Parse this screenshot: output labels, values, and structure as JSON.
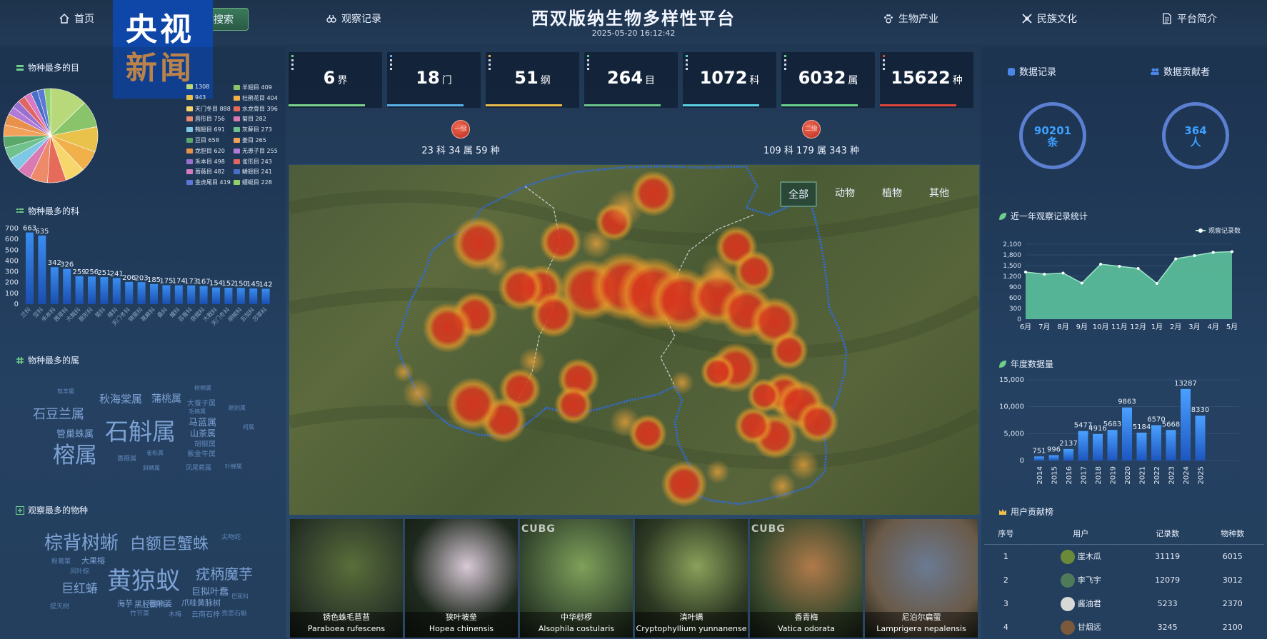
{
  "header": {
    "title": "西双版纳生物多样性平台",
    "datetime": "2025-05-20 16:12:42",
    "nav": {
      "home": "首页",
      "search": "物种搜索",
      "search_visible": "种搜索",
      "records": "观察记录",
      "industry": "生物产业",
      "culture": "民族文化",
      "about": "平台简介"
    }
  },
  "logo": {
    "line1": "央视",
    "line2": "新闻"
  },
  "left": {
    "order_title": "物种最多的目",
    "order_legend": [
      {
        "label": "1308",
        "color": "#b8d97a"
      },
      {
        "label": "半翅目 409",
        "color": "#8ac46a"
      },
      {
        "label": "943",
        "color": "#e8c24a"
      },
      {
        "label": "杜鹃花目 404",
        "color": "#f0b14a"
      },
      {
        "label": "天门冬目 888",
        "color": "#f7d66c"
      },
      {
        "label": "水龙骨目 396",
        "color": "#e56b5a"
      },
      {
        "label": "唇形目 756",
        "color": "#ec8a6a"
      },
      {
        "label": "菊目 282",
        "color": "#d97ab5"
      },
      {
        "label": "鞘翅目 691",
        "color": "#7ec8e6"
      },
      {
        "label": "灰藓目 273",
        "color": "#6fc18e"
      },
      {
        "label": "豆目 658",
        "color": "#5aa86a"
      },
      {
        "label": "姜目 265",
        "color": "#f2a15a"
      },
      {
        "label": "龙胆目 620",
        "color": "#e8914a"
      },
      {
        "label": "无患子目 255",
        "color": "#b07ad6"
      },
      {
        "label": "禾本目 498",
        "color": "#9a6fd0"
      },
      {
        "label": "雀形目 243",
        "color": "#e06666"
      },
      {
        "label": "蔷薇目 482",
        "color": "#d87ac2"
      },
      {
        "label": "鳞翅目 241",
        "color": "#4a6fc8"
      },
      {
        "label": "金虎尾目 419",
        "color": "#5a78d6"
      },
      {
        "label": "蜻蜓目 228",
        "color": "#8fd06a"
      }
    ],
    "order_pie": [
      1308,
      943,
      888,
      756,
      691,
      658,
      620,
      498,
      482,
      419,
      409,
      404,
      396,
      282,
      273,
      265,
      255,
      243,
      241,
      228
    ],
    "family_title": "物种最多的科",
    "genus_title": "物种最多的属",
    "genus_cloud": [
      "石斛属",
      "榕属",
      "石豆兰属",
      "秋海棠属",
      "蒲桃属",
      "马蓝属",
      "管巢蛛属",
      "山茶属",
      "大蚕子属",
      "胡椒属",
      "紫金牛属",
      "凤尾蕨属",
      "蔷薇属",
      "树棉属",
      "雀栎属",
      "叶蝉属",
      "柯属",
      "苞羊属",
      "毛楠属",
      "刷刺属",
      "斜鳞属"
    ],
    "species_title": "观察最多的物种",
    "species_cloud": [
      "黄猄蚁",
      "棕背树蜥",
      "白额巨蟹蛛",
      "疣柄魔芋",
      "巨红蝽",
      "巨拟叶蠢",
      "尖吻蛇",
      "黑胫鹅科",
      "大果榕",
      "爪哇黄脉树",
      "粉葛菜",
      "海芋",
      "苞叶姜",
      "提天树",
      "云南石梓",
      "巴蕉科",
      "木梅",
      "风叶棕",
      "竹节菜",
      "亮思石蜥"
    ]
  },
  "chart_data": [
    {
      "type": "pie",
      "title": "物种最多的目",
      "values": [
        1308,
        943,
        888,
        756,
        691,
        658,
        620,
        498,
        482,
        419,
        409,
        404,
        396,
        282,
        273,
        265,
        255,
        243,
        241,
        228
      ],
      "labels": [
        "",
        "",
        "天门冬目",
        "唇形目",
        "鞘翅目",
        "豆目",
        "龙胆目",
        "禾本目",
        "蔷薇目",
        "金虎尾目",
        "半翅目",
        "杜鹃花目",
        "水龙骨目",
        "菊目",
        "灰藓目",
        "姜目",
        "无患子目",
        "雀形目",
        "鳞翅目",
        "蜻蜓目"
      ]
    },
    {
      "type": "bar",
      "title": "物种最多的科",
      "categories": [
        "兰科",
        "豆科",
        "禾本科",
        "茜草科",
        "大戟科",
        "唇形科",
        "菊科",
        "樟科",
        "天门冬科",
        "锦葵科",
        "荨麻科",
        "桑科",
        "蝶科",
        "芸香科",
        "夜蛾科",
        "大戟科",
        "天门冬科",
        "胡椒科",
        "五加科",
        "莎草科"
      ],
      "values": [
        663,
        635,
        342,
        326,
        259,
        256,
        251,
        241,
        206,
        203,
        185,
        175,
        174,
        173,
        167,
        154,
        152,
        150,
        145,
        142
      ],
      "ylim": [
        0,
        700
      ],
      "yticks": [
        0,
        100,
        200,
        300,
        400,
        500,
        600,
        700
      ]
    },
    {
      "type": "area",
      "title": "近一年观察记录统计",
      "categories": [
        "6月",
        "7月",
        "8月",
        "9月",
        "10月",
        "11月",
        "12月",
        "1月",
        "2月",
        "3月",
        "4月",
        "5月"
      ],
      "series": [
        {
          "name": "观察记录数",
          "values": [
            1320,
            1260,
            1290,
            1010,
            1540,
            1480,
            1420,
            1000,
            1690,
            1780,
            1870,
            1890
          ]
        }
      ],
      "ylim": [
        0,
        2100
      ],
      "yticks": [
        0,
        300,
        600,
        900,
        1200,
        1500,
        1800,
        2100
      ]
    },
    {
      "type": "bar",
      "title": "年度数据量",
      "categories": [
        "2014",
        "2015",
        "2016",
        "2017",
        "2018",
        "2019",
        "2020",
        "2021",
        "2022",
        "2023",
        "2024",
        "2025"
      ],
      "values": [
        751,
        996,
        2137,
        5477,
        4916,
        5683,
        9863,
        5184,
        6570,
        5668,
        13287,
        8330
      ],
      "ylim": [
        0,
        15000
      ],
      "yticks": [
        0,
        5000,
        10000,
        15000
      ],
      "ytick_labels": [
        "0",
        "5,000",
        "10,000",
        "15,000"
      ]
    }
  ],
  "stats": [
    {
      "value": "6",
      "unit": "界",
      "color": "#7ad18a"
    },
    {
      "value": "18",
      "unit": "门",
      "color": "#5ab0e6"
    },
    {
      "value": "51",
      "unit": "纲",
      "color": "#e8b84a"
    },
    {
      "value": "264",
      "unit": "目",
      "color": "#6ac48a"
    },
    {
      "value": "1072",
      "unit": "科",
      "color": "#5ad0e0"
    },
    {
      "value": "6032",
      "unit": "属",
      "color": "#6ad08a"
    },
    {
      "value": "15622",
      "unit": "种",
      "color": "#e0463a"
    }
  ],
  "levels": [
    {
      "badge": "一级",
      "text": "23 科 34 属 59 种"
    },
    {
      "badge": "二级",
      "text": "109 科 179 属 343 种"
    }
  ],
  "map": {
    "filters": [
      "全部",
      "动物",
      "植物",
      "其他"
    ],
    "active": "全部"
  },
  "photos": [
    {
      "cn": "锈色蛛毛苣苔",
      "lat": "Paraboea rufescens",
      "bg": "#2d3a2a",
      "accent": "#5a6e3a"
    },
    {
      "cn": "狭叶坡垒",
      "lat": "Hopea chinensis",
      "bg": "#1f2a1e",
      "accent": "#d8c9d6"
    },
    {
      "cn": "中华桫椤",
      "lat": "Alsophila costularis",
      "bg": "#3a4e32",
      "accent": "#7fa05a",
      "watermark": "CUBG"
    },
    {
      "cn": "滇叶螨",
      "lat": "Cryptophyllium yunnanense",
      "bg": "#2e3a24",
      "accent": "#8aa05a"
    },
    {
      "cn": "香青梅",
      "lat": "Vatica odorata",
      "bg": "#3a4a2e",
      "accent": "#b07a4a",
      "watermark": "CUBG"
    },
    {
      "cn": "尼泊尔扁萤",
      "lat": "Lamprigera nepalensis",
      "bg": "#6a5a48",
      "accent": "#6a7a92"
    }
  ],
  "right": {
    "records_label": "数据记录",
    "contributors_label": "数据贡献者",
    "records_value": "90201",
    "records_unit": "条",
    "contributors_value": "364",
    "contributors_unit": "人",
    "trend_title": "近一年观察记录统计",
    "trend_legend": "观察记录数",
    "yearly_title": "年度数据量",
    "rank_title": "用户贡献榜",
    "rank_headers": [
      "序号",
      "用户",
      "记录数",
      "物种数"
    ],
    "rank_rows": [
      {
        "no": "1",
        "user": "崖木瓜",
        "records": "31119",
        "species": "6015"
      },
      {
        "no": "2",
        "user": "李飞宇",
        "records": "12079",
        "species": "3012"
      },
      {
        "no": "3",
        "user": "酱油君",
        "records": "5233",
        "species": "2370"
      },
      {
        "no": "4",
        "user": "甘烟远",
        "records": "3245",
        "species": "2100"
      }
    ]
  }
}
